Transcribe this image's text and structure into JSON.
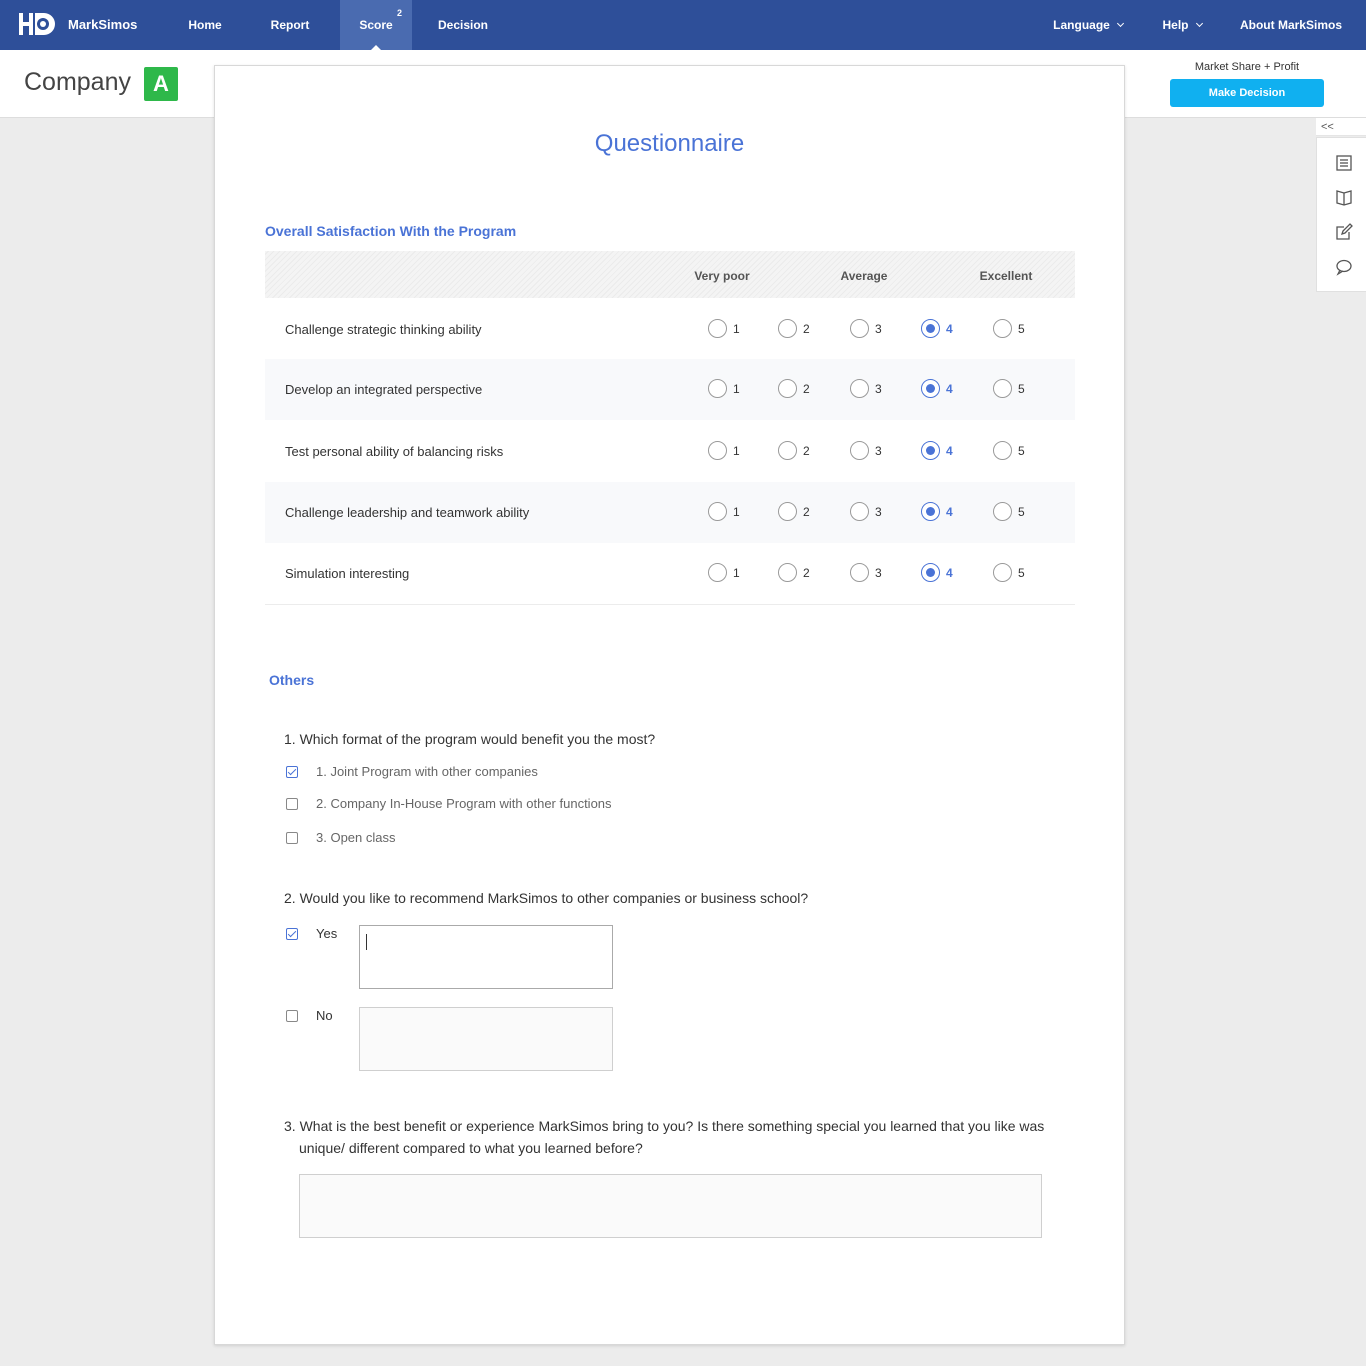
{
  "nav": {
    "brand": "MarkSimos",
    "items": [
      {
        "label": "Home"
      },
      {
        "label": "Report"
      },
      {
        "label": "Score",
        "badge": "2"
      },
      {
        "label": "Decision"
      }
    ],
    "right": {
      "language": "Language",
      "help": "Help",
      "about": "About MarkSimos"
    }
  },
  "header": {
    "company_label": "Company",
    "company_id": "A",
    "mode": "Market Share + Profit",
    "make_decision": "Make Decision"
  },
  "rail": {
    "toggle": "<<",
    "icons": [
      "document-icon",
      "book-icon",
      "edit-icon",
      "comment-icon"
    ]
  },
  "questionnaire": {
    "title": "Questionnaire",
    "section1": {
      "title": "Overall Satisfaction With the Program",
      "scale": {
        "low": "Very poor",
        "mid": "Average",
        "high": "Excellent"
      },
      "options": [
        "1",
        "2",
        "3",
        "4",
        "5"
      ],
      "rows": [
        {
          "question": "Challenge strategic thinking ability",
          "selected": "4"
        },
        {
          "question": "Develop an integrated perspective",
          "selected": "4"
        },
        {
          "question": "Test personal ability of  balancing risks",
          "selected": "4"
        },
        {
          "question": "Challenge leadership and teamwork ability",
          "selected": "4"
        },
        {
          "question": "Simulation interesting",
          "selected": "4"
        }
      ]
    },
    "section2": {
      "title": "Others",
      "q1": {
        "text": "1. Which format of the program would benefit you the most?",
        "options": [
          {
            "label": "1. Joint Program with other companies",
            "checked": true
          },
          {
            "label": "2. Company In-House Program with other functions",
            "checked": false
          },
          {
            "label": "3. Open class",
            "checked": false
          }
        ]
      },
      "q2": {
        "text": "2. Would you like to recommend MarkSimos to other companies or business school?",
        "yes": {
          "label": "Yes",
          "checked": true,
          "value": ""
        },
        "no": {
          "label": "No",
          "checked": false,
          "value": ""
        }
      },
      "q3": {
        "line1": "3. What is the best benefit or experience MarkSimos bring to you? Is there something special you learned that you like was",
        "line2": "unique/ different compared to what you learned before?",
        "value": ""
      }
    }
  },
  "colors": {
    "nav_bg": "#2e4f99",
    "accent": "#4a73d6",
    "button": "#10b0f0",
    "badge_green": "#2eb84a"
  }
}
